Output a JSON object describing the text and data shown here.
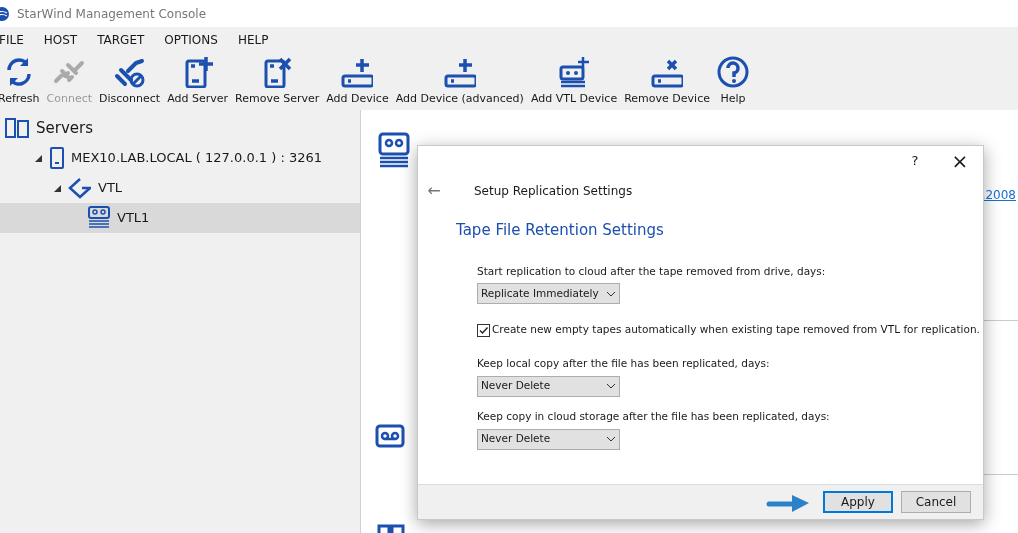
{
  "window": {
    "title": "StarWind Management Console"
  },
  "menu": [
    "FILE",
    "HOST",
    "TARGET",
    "OPTIONS",
    "HELP"
  ],
  "toolbar": [
    {
      "kind": "refresh",
      "label": "Refresh",
      "disabled": false
    },
    {
      "kind": "connect",
      "label": "Connect",
      "disabled": true
    },
    {
      "kind": "disconnect",
      "label": "Disconnect",
      "disabled": false
    },
    {
      "kind": "add-server",
      "label": "Add Server",
      "disabled": false
    },
    {
      "kind": "remove-server",
      "label": "Remove Server",
      "disabled": false
    },
    {
      "kind": "add-device",
      "label": "Add Device",
      "disabled": false
    },
    {
      "kind": "add-device",
      "label": "Add Device (advanced)",
      "disabled": false
    },
    {
      "kind": "add-vtl",
      "label": "Add VTL Device",
      "disabled": false
    },
    {
      "kind": "remove-device",
      "label": "Remove Device",
      "disabled": false
    },
    {
      "kind": "help",
      "label": "Help",
      "disabled": false
    }
  ],
  "tree": [
    {
      "kind": "servers",
      "label": "Servers",
      "selected": false,
      "children": [
        {
          "kind": "server",
          "label": "MEX10.LAB.LOCAL ( 127.0.0.1 ) : 3261",
          "expanded": true,
          "selected": false,
          "children": [
            {
              "kind": "vtl",
              "label": "VTL",
              "expanded": true,
              "selected": false,
              "children": [
                {
                  "kind": "tape",
                  "label": "VTL1",
                  "selected": true
                }
              ]
            }
          ]
        }
      ]
    }
  ],
  "background": {
    "link_fragment": ".2008"
  },
  "dialog": {
    "help": "?",
    "close": "×",
    "back": "←",
    "header": "Setup Replication Settings",
    "title": "Tape File Retention Settings",
    "fields": [
      {
        "kind": "select",
        "label": "Start replication to cloud after the tape removed from drive, days:",
        "value": "Replicate Immediately"
      },
      {
        "kind": "checkbox",
        "label": "Create new empty tapes automatically when existing tape removed from VTL for replication.",
        "checked": true
      },
      {
        "kind": "select",
        "label": "Keep local copy after the file has been replicated, days:",
        "value": "Never Delete"
      },
      {
        "kind": "select",
        "label": "Keep copy in cloud storage after the file has been replicated, days:",
        "value": "Never Delete"
      }
    ],
    "buttons": [
      {
        "label": "Apply",
        "default": true
      },
      {
        "label": "Cancel",
        "default": false
      }
    ]
  }
}
